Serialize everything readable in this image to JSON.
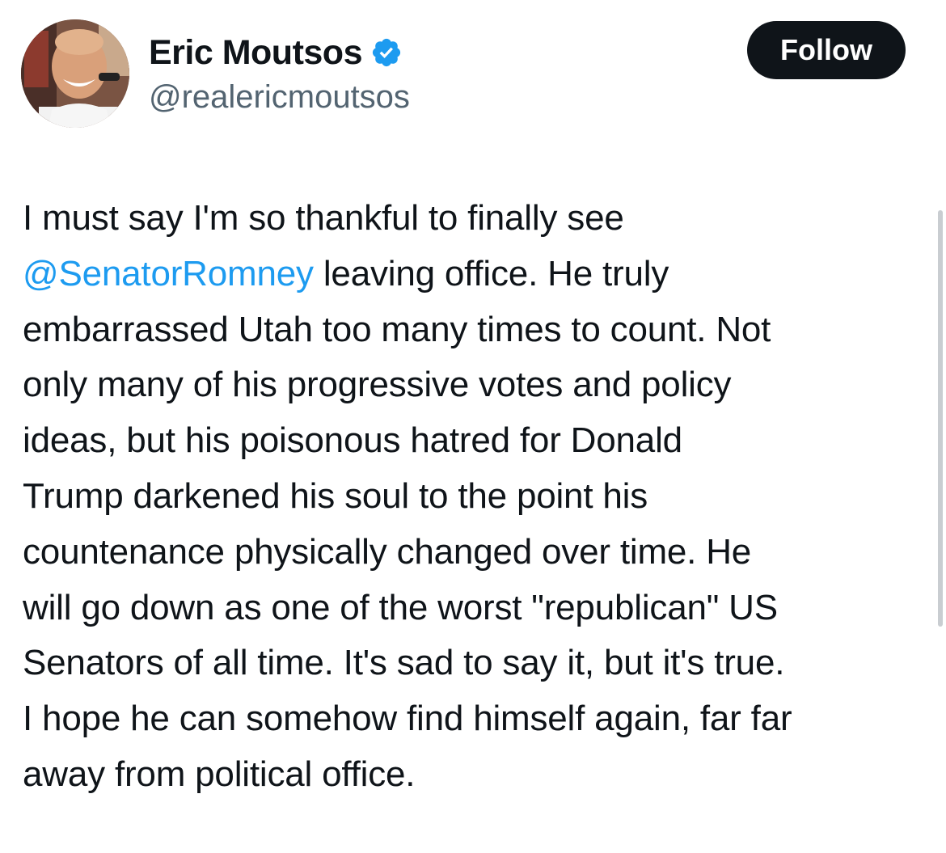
{
  "author": {
    "display_name": "Eric Moutsos",
    "handle": "@realericmoutsos",
    "verified_icon": "verified-badge-icon",
    "verified_color": "#1d9bf0"
  },
  "follow_button": {
    "label": "Follow"
  },
  "tweet": {
    "lines": [
      [
        {
          "text": "I must say I'm so thankful to finally see",
          "mention": false
        }
      ],
      [
        {
          "text": "@SenatorRomney",
          "mention": true
        },
        {
          "text": " leaving office. He truly",
          "mention": false
        }
      ],
      [
        {
          "text": "embarrassed Utah too many times to count. Not",
          "mention": false
        }
      ],
      [
        {
          "text": "only many of his progressive votes and policy",
          "mention": false
        }
      ],
      [
        {
          "text": "ideas, but his poisonous hatred for Donald",
          "mention": false
        }
      ],
      [
        {
          "text": "Trump darkened his soul to the point his",
          "mention": false
        }
      ],
      [
        {
          "text": "countenance physically changed over time. He",
          "mention": false
        }
      ],
      [
        {
          "text": "will go down as one of the worst \"republican\" US",
          "mention": false
        }
      ],
      [
        {
          "text": "Senators of all time. It's sad to say it, but it's true.",
          "mention": false
        }
      ],
      [
        {
          "text": "I hope he can somehow find himself again, far far",
          "mention": false
        }
      ],
      [
        {
          "text": "away from political office.",
          "mention": false
        }
      ]
    ]
  },
  "colors": {
    "text": "#0f1419",
    "secondary": "#536471",
    "link": "#1d9bf0",
    "button_bg": "#0f1419",
    "button_text": "#ffffff"
  }
}
